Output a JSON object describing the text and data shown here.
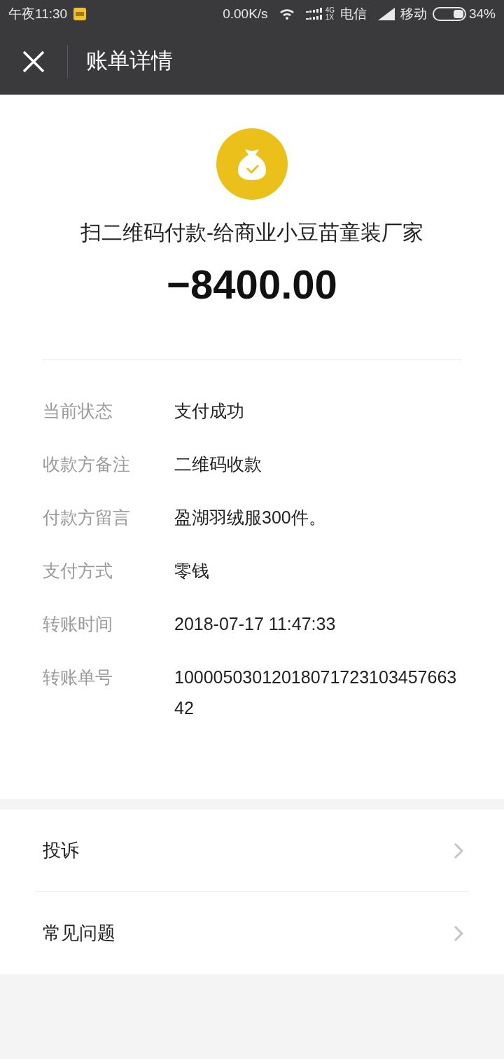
{
  "status_bar": {
    "time": "午夜11:30",
    "speed": "0.00K/s",
    "net_top": "4G",
    "net_bottom": "1X",
    "carrier_1": "电信",
    "carrier_2": "移动",
    "battery": "34%"
  },
  "nav": {
    "title": "账单详情"
  },
  "summary": {
    "title": "扫二维码付款-给商业小豆苗童装厂家",
    "amount": "−8400.00"
  },
  "details": [
    {
      "label": "当前状态",
      "value": "支付成功"
    },
    {
      "label": "收款方备注",
      "value": "二维码收款"
    },
    {
      "label": "付款方留言",
      "value": "盈湖羽绒服300件。"
    },
    {
      "label": "支付方式",
      "value": "零钱"
    },
    {
      "label": "转账时间",
      "value": "2018-07-17 11:47:33"
    },
    {
      "label": "转账单号",
      "value": "1000050301201807172310345766342"
    }
  ],
  "links": [
    {
      "label": "投诉"
    },
    {
      "label": "常见问题"
    }
  ]
}
